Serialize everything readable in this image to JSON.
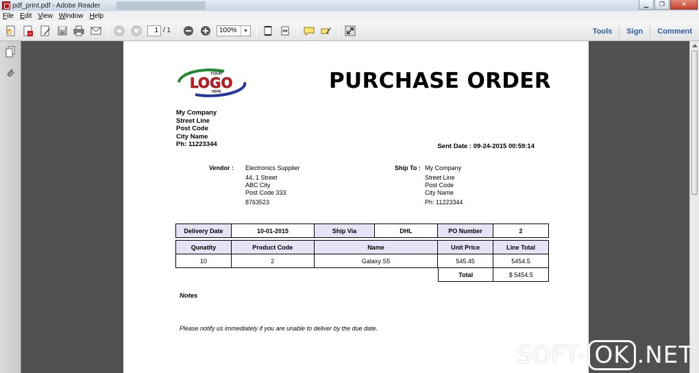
{
  "window": {
    "title": "pdf_print.pdf - Adobe Reader"
  },
  "menu": [
    {
      "label": "File",
      "u": "F",
      "rest": "ile"
    },
    {
      "label": "Edit",
      "u": "E",
      "rest": "dit"
    },
    {
      "label": "View",
      "u": "V",
      "rest": "iew"
    },
    {
      "label": "Window",
      "u": "W",
      "rest": "indow"
    },
    {
      "label": "Help",
      "u": "H",
      "rest": "elp"
    }
  ],
  "toolbar": {
    "page_current": "1",
    "page_total": "/ 1",
    "zoom": "100%",
    "tools": "Tools",
    "sign": "Sign",
    "comment": "Comment"
  },
  "doc": {
    "logo": {
      "top": "YOUR",
      "main": "LOGO",
      "bottom": "HERE"
    },
    "title": "PURCHASE ORDER",
    "company": [
      "My Company",
      "Street Line",
      "Post Code",
      "City Name",
      "Ph: 11223344"
    ],
    "sent_date": "Sent Date : 09-24-2015 00:59:14",
    "vendor_label": "Vendor :",
    "vendor": [
      "Electronics Supplier",
      "44, 1 Street",
      "ABC City",
      "Post Code 333",
      "8763523"
    ],
    "ship_to_label": "Ship To :",
    "ship_to": [
      "My Company",
      "Street Line",
      "Post Code",
      "City Name",
      "Ph: 11223344"
    ],
    "order_info": {
      "delivery_date_label": "Delivery Date",
      "delivery_date": "10-01-2015",
      "ship_via_label": "Ship Via",
      "ship_via": "DHL",
      "po_number_label": "PO Number",
      "po_number": "2"
    },
    "items_headers": [
      "Qunatity",
      "Product Code",
      "Name",
      "Unit Price",
      "Line Total"
    ],
    "items": [
      {
        "qty": "10",
        "code": "2",
        "name": "Galaxy S5",
        "unit_price": "545.45",
        "line_total": "5454.5"
      }
    ],
    "total_label": "Total",
    "total": "$ 5454.5",
    "notes_label": "Notes",
    "notes_text": "Please notify us immediately if you are unable to deliver by the due date."
  },
  "watermark": {
    "pre": "SOFT-",
    "ok": "OK",
    "post": ".NET"
  },
  "colors": {
    "accent_link": "#2c5b9b",
    "table_header": "#e4e4f6",
    "logo_red": "#d4121c",
    "logo_green": "#1f8a2e",
    "logo_blue": "#24349b"
  }
}
